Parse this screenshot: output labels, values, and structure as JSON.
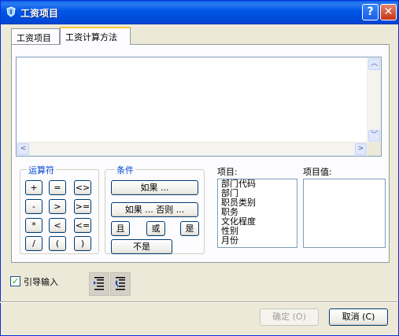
{
  "window": {
    "title": "工资项目",
    "help_label": "?",
    "close_label": "✕"
  },
  "tabs": [
    {
      "label": "工资项目",
      "selected": false
    },
    {
      "label": "工资计算方法",
      "selected": true
    }
  ],
  "editor": {
    "value": ""
  },
  "operators": {
    "label": "运算符",
    "items": [
      "+",
      "=",
      "<>",
      "-",
      ">",
      ">=",
      "*",
      "<",
      "<=",
      "/",
      "(",
      ")"
    ]
  },
  "conditions": {
    "label": "条件",
    "if": "如果 ...",
    "if_else": "如果 ... 否则 ...",
    "and": "且",
    "or": "或",
    "is": "是",
    "not": "不是"
  },
  "fields": {
    "label": "项目:",
    "items": [
      "部门代码",
      "部门",
      "职员类别",
      "职务",
      "文化程度",
      "性别",
      "月份"
    ]
  },
  "field_values": {
    "label": "项目值:",
    "items": []
  },
  "guide": {
    "label": "引导输入",
    "checked": true
  },
  "buttons": {
    "ok": "确定 (O)",
    "cancel": "取消 (C)"
  },
  "colors": {
    "title_bar": "#0055e5",
    "group_label": "#0046d5",
    "face": "#ece9d8"
  }
}
